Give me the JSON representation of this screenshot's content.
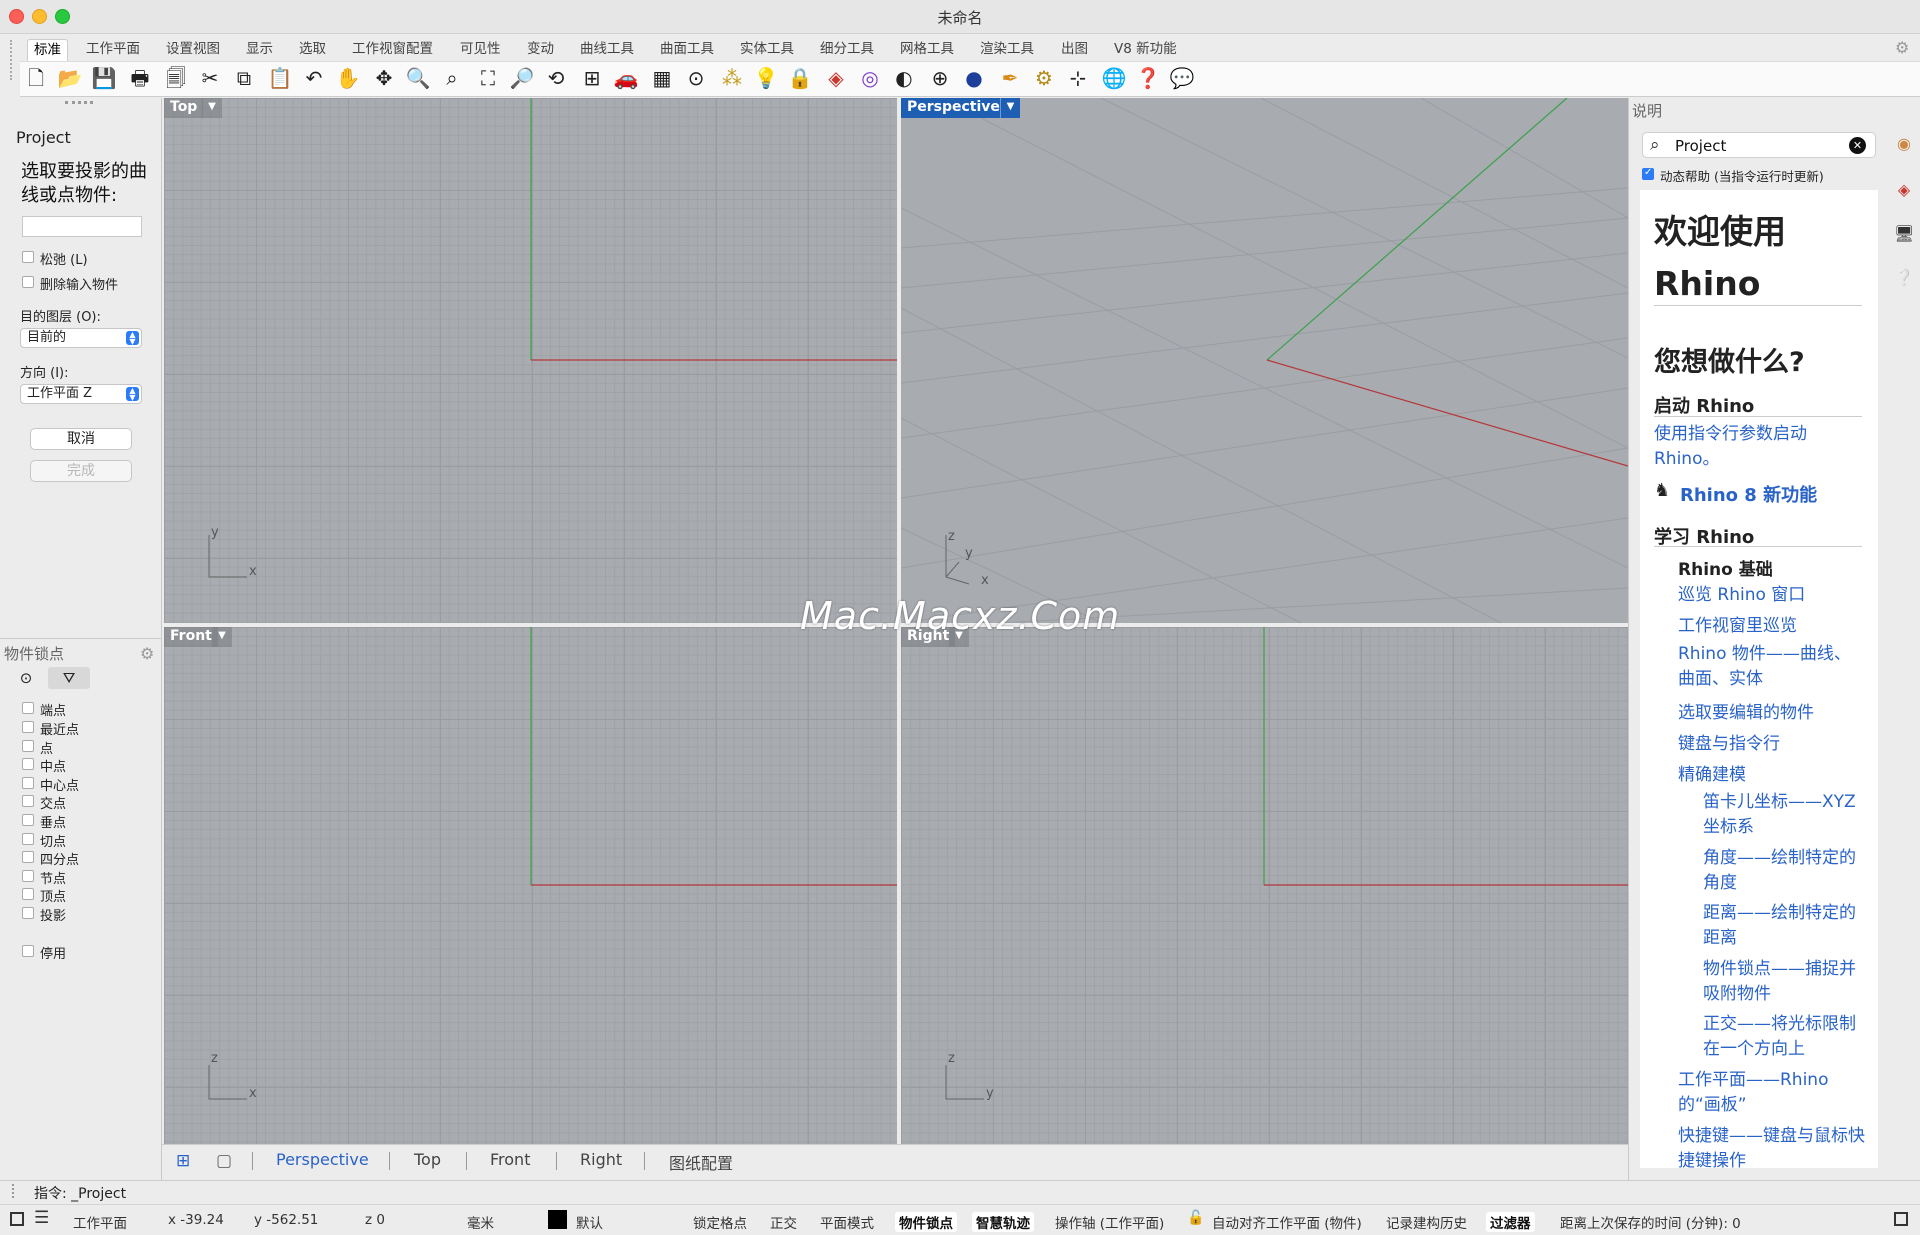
{
  "window": {
    "title": "未命名"
  },
  "tabs": [
    "标准",
    "工作平面",
    "设置视图",
    "显示",
    "选取",
    "工作视窗配置",
    "可见性",
    "变动",
    "曲线工具",
    "曲面工具",
    "实体工具",
    "细分工具",
    "网格工具",
    "渲染工具",
    "出图",
    "V8 新功能"
  ],
  "toolbar_icons": [
    "new-file-icon",
    "open-folder-icon",
    "save-icon",
    "print-icon",
    "import-icon",
    "cut-icon",
    "copy-icon",
    "paste-icon",
    "undo-icon",
    "pan-hand-icon",
    "rotate-view-icon",
    "zoom-icon",
    "zoom-window-icon",
    "zoom-extents-icon",
    "zoom-selected-icon",
    "undo-view-icon",
    "four-viewports-icon",
    "car-icon",
    "plane-grid-icon",
    "osnap-icon",
    "point-icon",
    "light-bulb-icon",
    "lock-icon",
    "layer-icon",
    "color-wheel-icon",
    "shaded-sphere-icon",
    "wire-sphere-icon",
    "render-sphere-icon",
    "pen-nib-icon",
    "gear-options-icon",
    "gumball-icon",
    "globe-icon",
    "help-icon",
    "chat-icon"
  ],
  "command_panel": {
    "command_name": "Project",
    "prompt": "选取要投影的曲线或点物件:",
    "input_value": "",
    "options": [
      {
        "label": "松弛 (L)",
        "checked": false
      },
      {
        "label": "删除输入物件",
        "checked": false
      }
    ],
    "layer_label": "目的图层 (O):",
    "layer_value": "目前的",
    "direction_label": "方向 (I):",
    "direction_value": "工作平面 Z",
    "cancel_label": "取消",
    "done_label": "完成"
  },
  "osnap": {
    "title": "物件锁点",
    "items": [
      "端点",
      "最近点",
      "点",
      "中点",
      "中心点",
      "交点",
      "垂点",
      "切点",
      "四分点",
      "节点",
      "顶点",
      "投影"
    ],
    "disable_label": "停用"
  },
  "viewports": {
    "top": {
      "label": "Top",
      "axes": [
        "y",
        "x"
      ]
    },
    "perspective": {
      "label": "Perspective",
      "axes": [
        "z",
        "y",
        "x"
      ]
    },
    "front": {
      "label": "Front",
      "axes": [
        "z",
        "x"
      ]
    },
    "right": {
      "label": "Right",
      "axes": [
        "z",
        "y"
      ]
    }
  },
  "watermark": "Mac.Macxz.Com",
  "viewport_tabs": [
    "Perspective",
    "Top",
    "Front",
    "Right",
    "图纸配置"
  ],
  "help_panel": {
    "title": "说明",
    "search_value": "Project",
    "dynamic_help_label": "动态帮助 (当指令运行时更新)",
    "dynamic_help_checked": true,
    "heading_1": "欢迎使用",
    "heading_1b": "Rhino",
    "heading_2": "您想做什么?",
    "section_launch": "启动 Rhino",
    "link_cmdline": "使用指令行参数启动 Rhino。",
    "link_new": "Rhino 8 新功能",
    "section_learn": "学习 Rhino",
    "basics": "Rhino 基础",
    "links": [
      "巡览 Rhino 窗口",
      "工作视窗里巡览",
      "Rhino 物件——曲线、曲面、实体",
      "选取要编辑的物件",
      "键盘与指令行",
      "精确建模"
    ],
    "sublinks": [
      "笛卡儿坐标——XYZ坐标系",
      "角度——绘制特定的角度",
      "距离——绘制特定的距离",
      "物件锁点——捕捉并吸附物件",
      "正交——将光标限制在一个方向上"
    ],
    "links2": [
      "工作平面——Rhino 的“画板”",
      "快捷键——键盘与鼠标快捷键操作"
    ]
  },
  "command_line": "指令: _Project",
  "status": {
    "cplane": "工作平面",
    "x": "x -39.24",
    "y": "y -562.51",
    "z": "z 0",
    "units": "毫米",
    "layer": "默认",
    "grid_snap": "锁定格点",
    "ortho": "正交",
    "planar": "平面模式",
    "osnap": "物件锁点",
    "smarttrack": "智慧轨迹",
    "gumball": "操作轴 (工作平面)",
    "autoalign": "自动对齐工作平面 (物件)",
    "history": "记录建构历史",
    "filter": "过滤器",
    "last_save": "距离上次保存的时间 (分钟): 0"
  },
  "colors": {
    "active_blue": "#1e5fb4",
    "link_blue": "#2a63c8",
    "x_axis": "#b5363a",
    "y_axis": "#3aa14a"
  }
}
